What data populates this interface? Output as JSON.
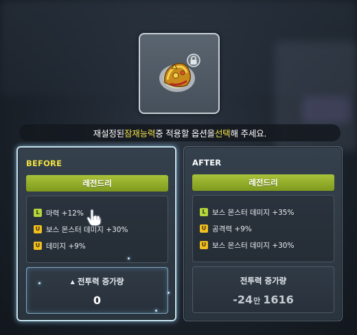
{
  "instruction": {
    "part1": "재설정된 ",
    "highlight1": "잠재능력",
    "part2": " 중 적용할 옵션을 ",
    "highlight2": "선택",
    "part3": "해 주세요."
  },
  "before": {
    "title": "BEFORE",
    "grade": "레전드리",
    "options": [
      {
        "tier": "L",
        "text": "마력 +12%"
      },
      {
        "tier": "U",
        "text": "보스 몬스터 데미지 +30%"
      },
      {
        "tier": "U",
        "text": "데미지 +9%"
      }
    ],
    "power_label": "전투력 증가량",
    "power_value": "0"
  },
  "after": {
    "title": "AFTER",
    "grade": "레전드리",
    "options": [
      {
        "tier": "L",
        "text": "보스 몬스터 데미지 +35%"
      },
      {
        "tier": "U",
        "text": "공격력 +9%"
      },
      {
        "tier": "U",
        "text": "보스 몬스터 데미지 +30%"
      }
    ],
    "power_label": "전투력 증가량",
    "power_value_main": "-24",
    "power_value_unit": "만",
    "power_value_rest": "1616"
  },
  "icons": {
    "item": "golden-helmet-item-icon",
    "lock": "lock-icon",
    "cursor": "hand-pointer-icon",
    "arrow": "triangle-up-icon"
  },
  "colors": {
    "highlight": "#f3e44a",
    "grade_green": "#9ab52d",
    "legendary_badge": "#b6d53c",
    "unique_badge": "#f0c020"
  }
}
